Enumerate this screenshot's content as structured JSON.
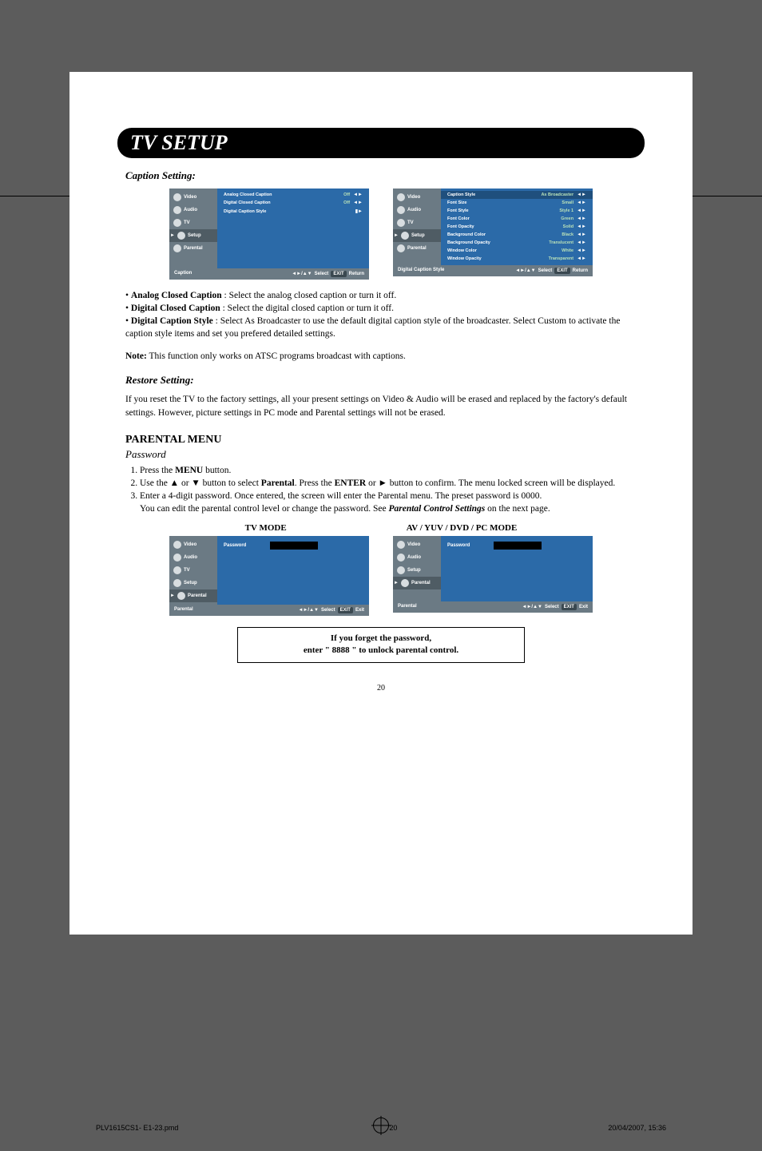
{
  "cropColorsLeft": [
    "#000000",
    "#d40000",
    "#888888",
    "#d4d400",
    "#bbbbbb",
    "#00a800",
    "#dddddd",
    "#00b0d4"
  ],
  "cropColorsRight": [
    "#dddddd",
    "#d400d4",
    "#bbbbbb",
    "#0000d4",
    "#888888",
    "#00a800",
    "#000000",
    "#d40000"
  ],
  "banner": "TV SETUP",
  "captionSetting": {
    "heading": "Caption Setting:",
    "osd1": {
      "side": [
        "Video",
        "Audio",
        "TV",
        "Setup",
        "Parental"
      ],
      "rows": [
        {
          "label": "Analog Closed Caption",
          "value": "Off",
          "arrow": "◄►"
        },
        {
          "label": "Digital Closed Caption",
          "value": "Off",
          "arrow": "◄►"
        },
        {
          "label": "Digital Caption Style",
          "value": "",
          "arrow": "▮►"
        }
      ],
      "footerLeft": "Caption",
      "footerRight": [
        "◄►/▲▼",
        "Select",
        "EXIT",
        "Return"
      ]
    },
    "osd2": {
      "side": [
        "Video",
        "Audio",
        "TV",
        "Setup",
        "Parental"
      ],
      "rows": [
        {
          "label": "Caption Style",
          "value": "As Broadcaster",
          "arrow": "◄►",
          "hl": true
        },
        {
          "label": "Font Size",
          "value": "Small",
          "arrow": "◄►"
        },
        {
          "label": "Font Style",
          "value": "Style 1",
          "arrow": "◄►"
        },
        {
          "label": "Font Color",
          "value": "Green",
          "arrow": "◄►"
        },
        {
          "label": "Font Opacity",
          "value": "Solid",
          "arrow": "◄►"
        },
        {
          "label": "Background Color",
          "value": "Black",
          "arrow": "◄►"
        },
        {
          "label": "Background Opacity",
          "value": "Translucent",
          "arrow": "◄►"
        },
        {
          "label": "Window Color",
          "value": "White",
          "arrow": "◄►"
        },
        {
          "label": "Window Opacity",
          "value": "Transparent",
          "arrow": "◄►"
        }
      ],
      "footerLeft": "Digital Caption Style",
      "footerRight": [
        "◄►/▲▼",
        "Select",
        "EXIT",
        "Return"
      ]
    },
    "bullets": [
      {
        "term": "Analog Closed Caption",
        "sep": " : ",
        "desc": "Select the analog closed caption or turn it off."
      },
      {
        "term": "Digital Closed Caption",
        "sep": " : ",
        "desc": "Select the digital closed caption or turn it off."
      },
      {
        "term": "Digital Caption Style",
        "sep": " : ",
        "desc": "Select As Broadcaster to use the default digital caption style of the broadcaster. Select Custom to activate the caption style items and set you prefered detailed settings."
      }
    ],
    "noteLabel": "Note:",
    "noteText": " This function only works on ATSC programs broadcast with captions."
  },
  "restore": {
    "heading": "Restore Setting:",
    "text": "If you reset the TV to the factory settings, all your present settings on Video & Audio will be erased and replaced by the factory's default settings. However, picture settings in PC mode and Parental settings will not be erased."
  },
  "parental": {
    "heading": "PARENTAL MENU",
    "sub": "Password",
    "step1_a": "Press the ",
    "step1_b": "MENU",
    "step1_c": " button.",
    "step2_a": "Use the ▲ or ▼ button to select ",
    "step2_b": "Parental",
    "step2_c": ". Press the ",
    "step2_d": "ENTER",
    "step2_e": " or ► button to confirm. The menu locked screen will be displayed.",
    "step3_a": "Enter a 4-digit password. Once entered, the screen will enter the Parental menu. The preset password is 0000.",
    "step3_b": "You can edit the parental control level or change the password. See ",
    "step3_c": "Parental Control Settings",
    "step3_d": " on the next page.",
    "modeLeft": "TV MODE",
    "modeRight": "AV / YUV / DVD / PC  MODE",
    "osd3": {
      "side": [
        "Video",
        "Audio",
        "TV",
        "Setup",
        "Parental"
      ],
      "pwLabel": "Password",
      "footerLeft": "Parental",
      "footerRight": [
        "◄►/▲▼",
        "Select",
        "EXIT",
        "Exit"
      ]
    },
    "osd4": {
      "side": [
        "Video",
        "Audio",
        "Setup",
        "Parental"
      ],
      "pwLabel": "Password",
      "footerLeft": "Parental",
      "footerRight": [
        "◄►/▲▼",
        "Select",
        "EXIT",
        "Exit"
      ]
    },
    "hint1": "If you forget the password,",
    "hint2": "enter \" 8888 \" to unlock parental control."
  },
  "pageNum": "20",
  "footer": {
    "file": "PLV1615CS1- E1-23.pmd",
    "page": "20",
    "date": "20/04/2007, 15:36"
  }
}
